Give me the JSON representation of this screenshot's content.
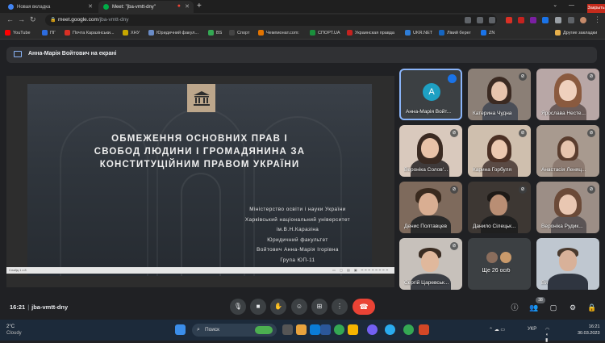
{
  "browser": {
    "tabs": [
      {
        "title": "Новая вкладка",
        "active": false
      },
      {
        "title": "Meet: \"jba-vmtt-dny\"",
        "active": true
      }
    ],
    "new_tab_icon": "plus-icon",
    "close_button_label": "Закрыть",
    "url_domain": "meet.google.com",
    "url_path": "/jba-vmtt-dny"
  },
  "bookmarks": [
    {
      "label": "YouTube",
      "color": "#ff0000"
    },
    {
      "label": "ПГ",
      "color": "#2d6cdf"
    },
    {
      "label": "Почта Каразінськи...",
      "color": "#d93025"
    },
    {
      "label": "ХНУ",
      "color": "#c6a700"
    },
    {
      "label": "Юридичний факул...",
      "color": "#6a8cc7"
    },
    {
      "label": "BS",
      "color": "#34a853"
    },
    {
      "label": "Спорт",
      "color": "#444444"
    },
    {
      "label": "Чемпионат.com:",
      "color": "#e37400"
    },
    {
      "label": "СПОРТ.UA",
      "color": "#1a8f3c"
    },
    {
      "label": "Украинская правда",
      "color": "#c5221f"
    },
    {
      "label": "UKR.NET",
      "color": "#2e7dd7"
    },
    {
      "label": "Лівий берег",
      "color": "#1565c0"
    },
    {
      "label": "ZN",
      "color": "#1a73e8"
    }
  ],
  "bookmarks_other": "Другие закладки",
  "meet": {
    "presenting_banner": "Анна-Марія Войтович на екрані",
    "slide": {
      "title_lines": [
        "ОБМЕЖЕННЯ ОСНОВНИХ ПРАВ І",
        "СВОБОД ЛЮДИНИ І ГРОМАДЯНИНА ЗА",
        "КОНСТИТУЦІЙНИМ ПРАВОМ УКРАЇНИ"
      ],
      "info_lines": [
        "Міністерство освіти і науки України",
        "Харківський національний університет",
        "ім.В.Н.Каразіна",
        "Юридичний факультет",
        "Войтович Анна-Марія Ігорівна",
        "Група ЮП-11"
      ],
      "footer_text": "Слайд 1 з 8"
    },
    "participants": [
      {
        "name": "Анна-Марія Войт...",
        "initial": "А"
      },
      {
        "name": "Катерина Чудна"
      },
      {
        "name": "Ярослава Несте..."
      },
      {
        "name": "Вероніка Солов'..."
      },
      {
        "name": "Карина Горбуля"
      },
      {
        "name": "Анастасія Леняц..."
      },
      {
        "name": "Денис Полтавцев"
      },
      {
        "name": "Данило Сілецьк..."
      },
      {
        "name": "Вероніка Рудик..."
      },
      {
        "name": "Сергій Царевськ..."
      },
      {
        "name": "Ще 26 осіб"
      },
      {
        "name": "Ви"
      }
    ],
    "time": "16:21",
    "meeting_code": "jba-vmtt-dny",
    "participant_count": "38"
  },
  "taskbar": {
    "temperature": "2°C",
    "weather": "Cloudy",
    "search_placeholder": "Поиск",
    "language": "УКР",
    "time": "16:21",
    "date": "30.03.2023"
  }
}
